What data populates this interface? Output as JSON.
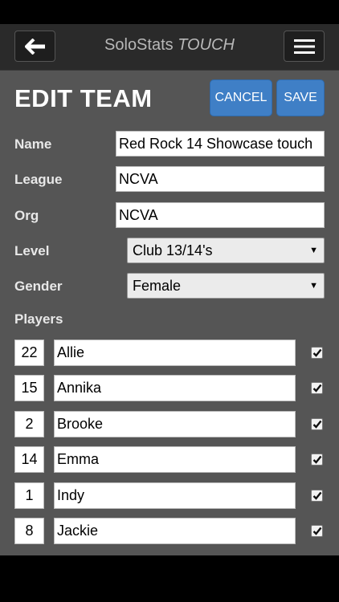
{
  "app": {
    "title_main": "SoloStats",
    "title_accent": "TOUCH"
  },
  "header": {
    "page_title": "EDIT TEAM",
    "cancel_label": "CANCEL",
    "save_label": "SAVE"
  },
  "form": {
    "name_label": "Name",
    "name_value": "Red Rock 14 Showcase touch",
    "league_label": "League",
    "league_value": "NCVA",
    "org_label": "Org",
    "org_value": "NCVA",
    "level_label": "Level",
    "level_value": "Club 13/14's",
    "gender_label": "Gender",
    "gender_value": "Female",
    "players_label": "Players"
  },
  "players": [
    {
      "number": "22",
      "name": "Allie",
      "checked": true
    },
    {
      "number": "15",
      "name": "Annika",
      "checked": true
    },
    {
      "number": "2",
      "name": "Brooke",
      "checked": true
    },
    {
      "number": "14",
      "name": "Emma",
      "checked": true
    },
    {
      "number": "1",
      "name": "Indy",
      "checked": true
    },
    {
      "number": "8",
      "name": "Jackie",
      "checked": true
    }
  ],
  "icons": {
    "back": "arrow-left-icon",
    "menu": "hamburger-menu-icon",
    "select": "dropdown-arrow-icon",
    "check": "checkmark-icon"
  },
  "colors": {
    "accent": "#3f7fc6",
    "nav_bg": "#2a2a2a",
    "content_bg": "#555555"
  }
}
